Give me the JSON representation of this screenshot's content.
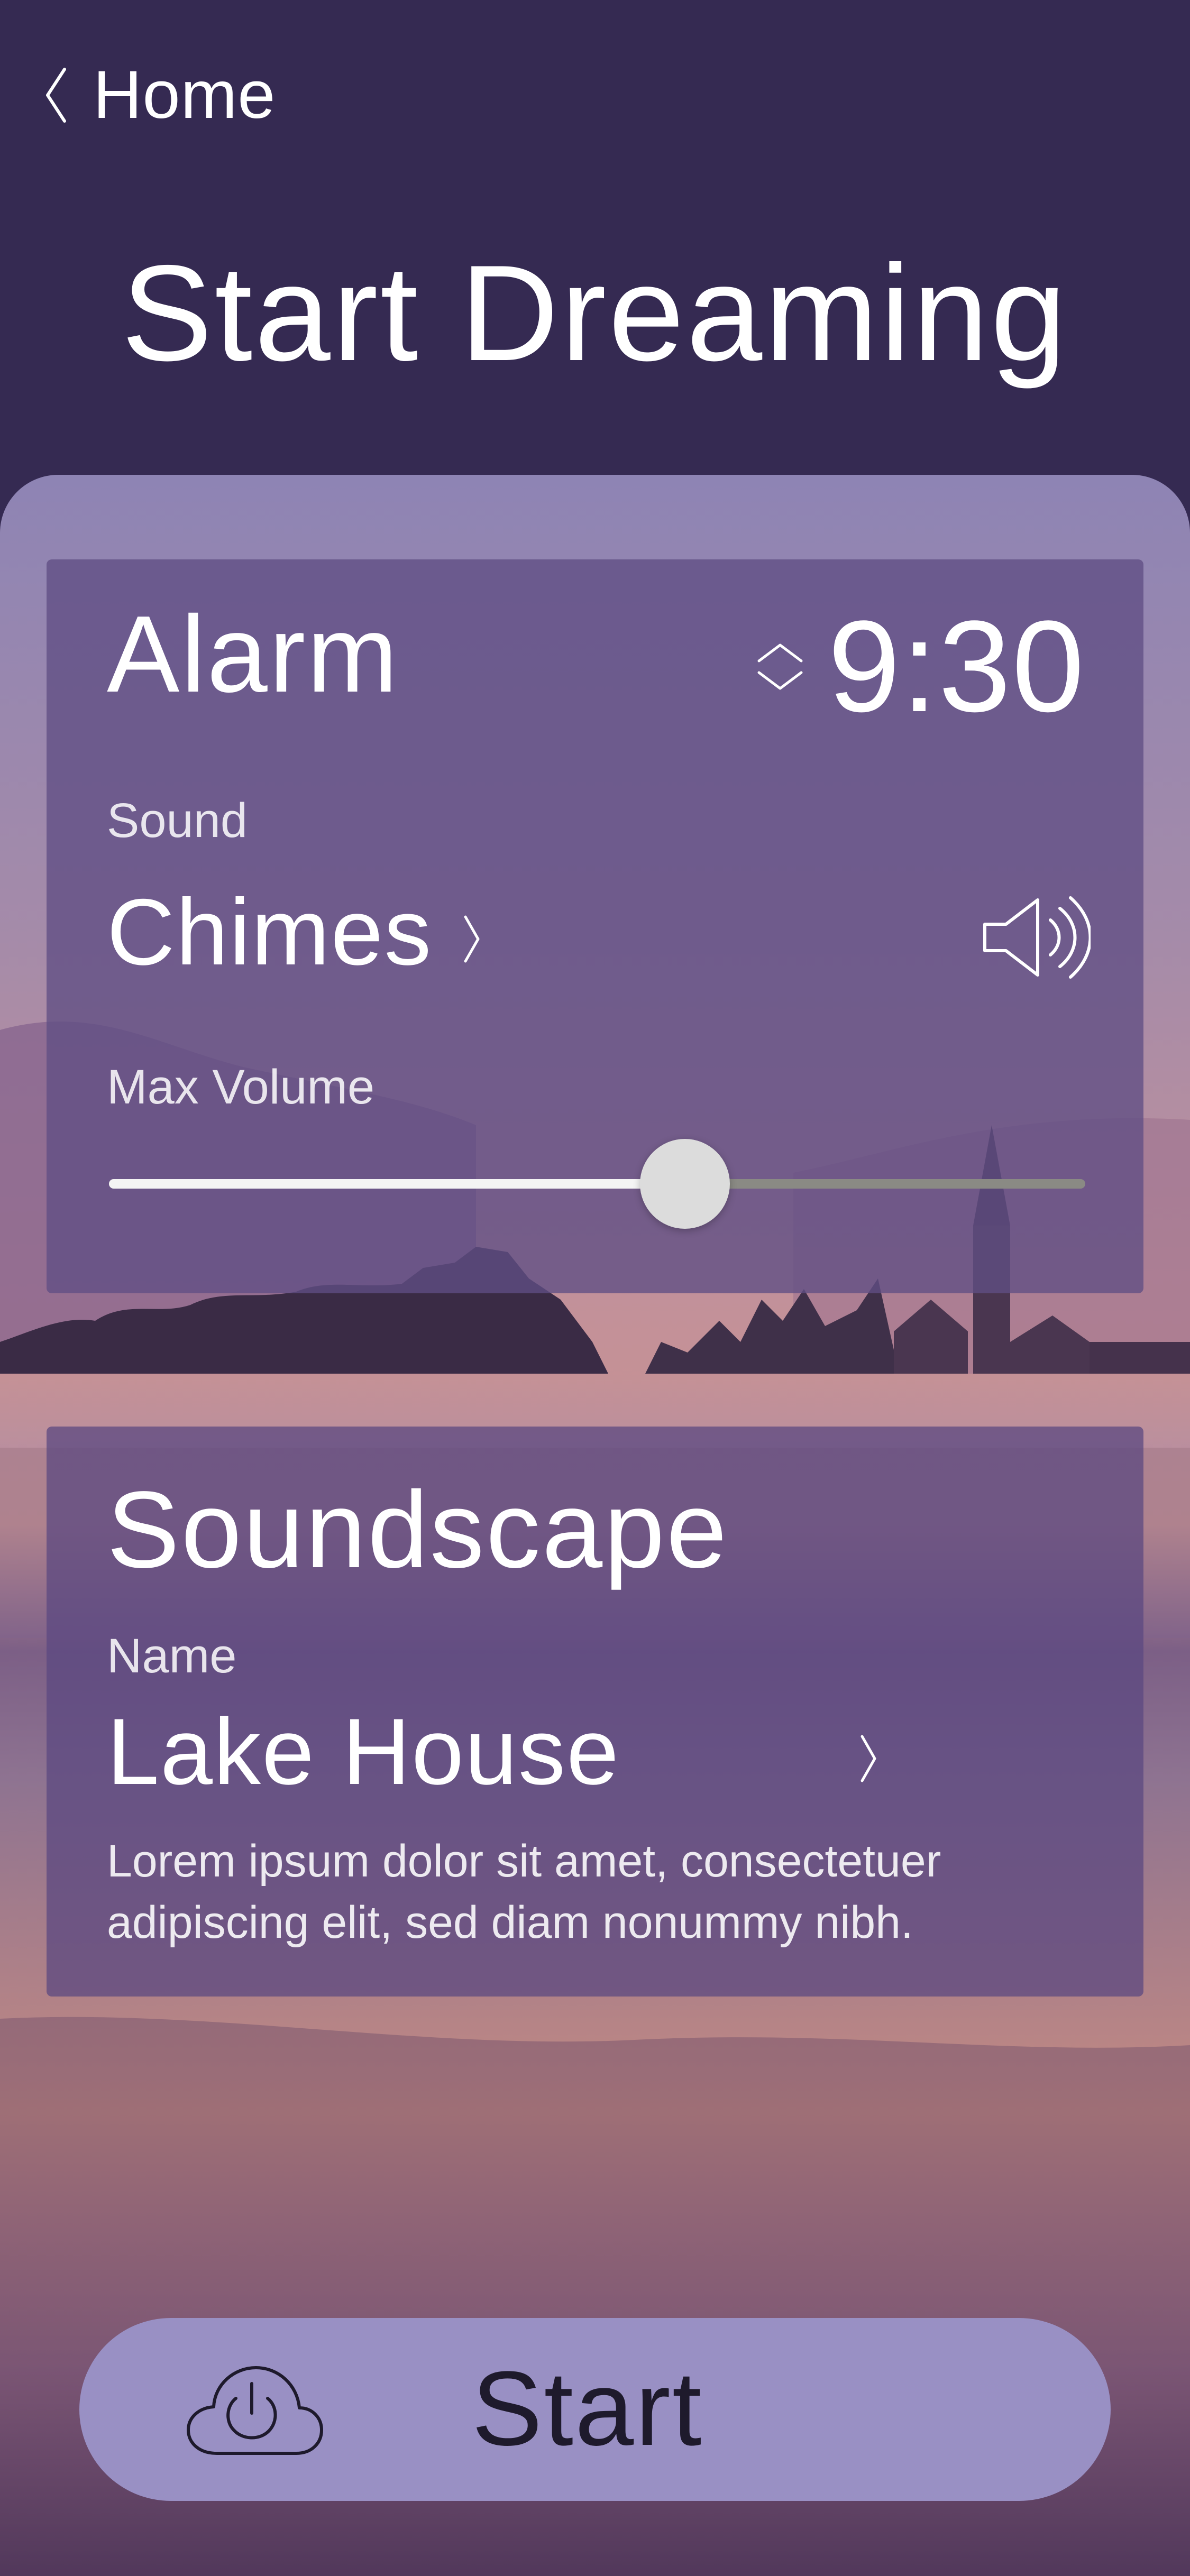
{
  "header": {
    "back_label": "Home",
    "title": "Start Dreaming"
  },
  "alarm": {
    "heading": "Alarm",
    "time": "9:30",
    "sound_label": "Sound",
    "sound_value": "Chimes",
    "volume_label": "Max Volume",
    "volume_level": 0.59
  },
  "soundscape": {
    "heading": "Soundscape",
    "name_label": "Name",
    "name_value": "Lake House",
    "description": "Lorem ipsum dolor sit amet, consectetuer adipiscing elit, sed diam nonummy nibh."
  },
  "start_button": {
    "label": "Start"
  },
  "icons": {
    "back": "chevron-left-icon",
    "time_stepper": "up-down-chevron-icon",
    "sound_chevron": "chevron-right-icon",
    "speaker": "speaker-volume-icon",
    "soundscape_chevron": "chevron-right-icon",
    "start": "cloud-power-icon"
  },
  "colors": {
    "background": "#352a52",
    "card": "#604e84",
    "button": "#9990c4",
    "slider_fill": "#f4f4f4",
    "slider_track": "#8a8a84",
    "slider_thumb": "#dcdcdc"
  }
}
